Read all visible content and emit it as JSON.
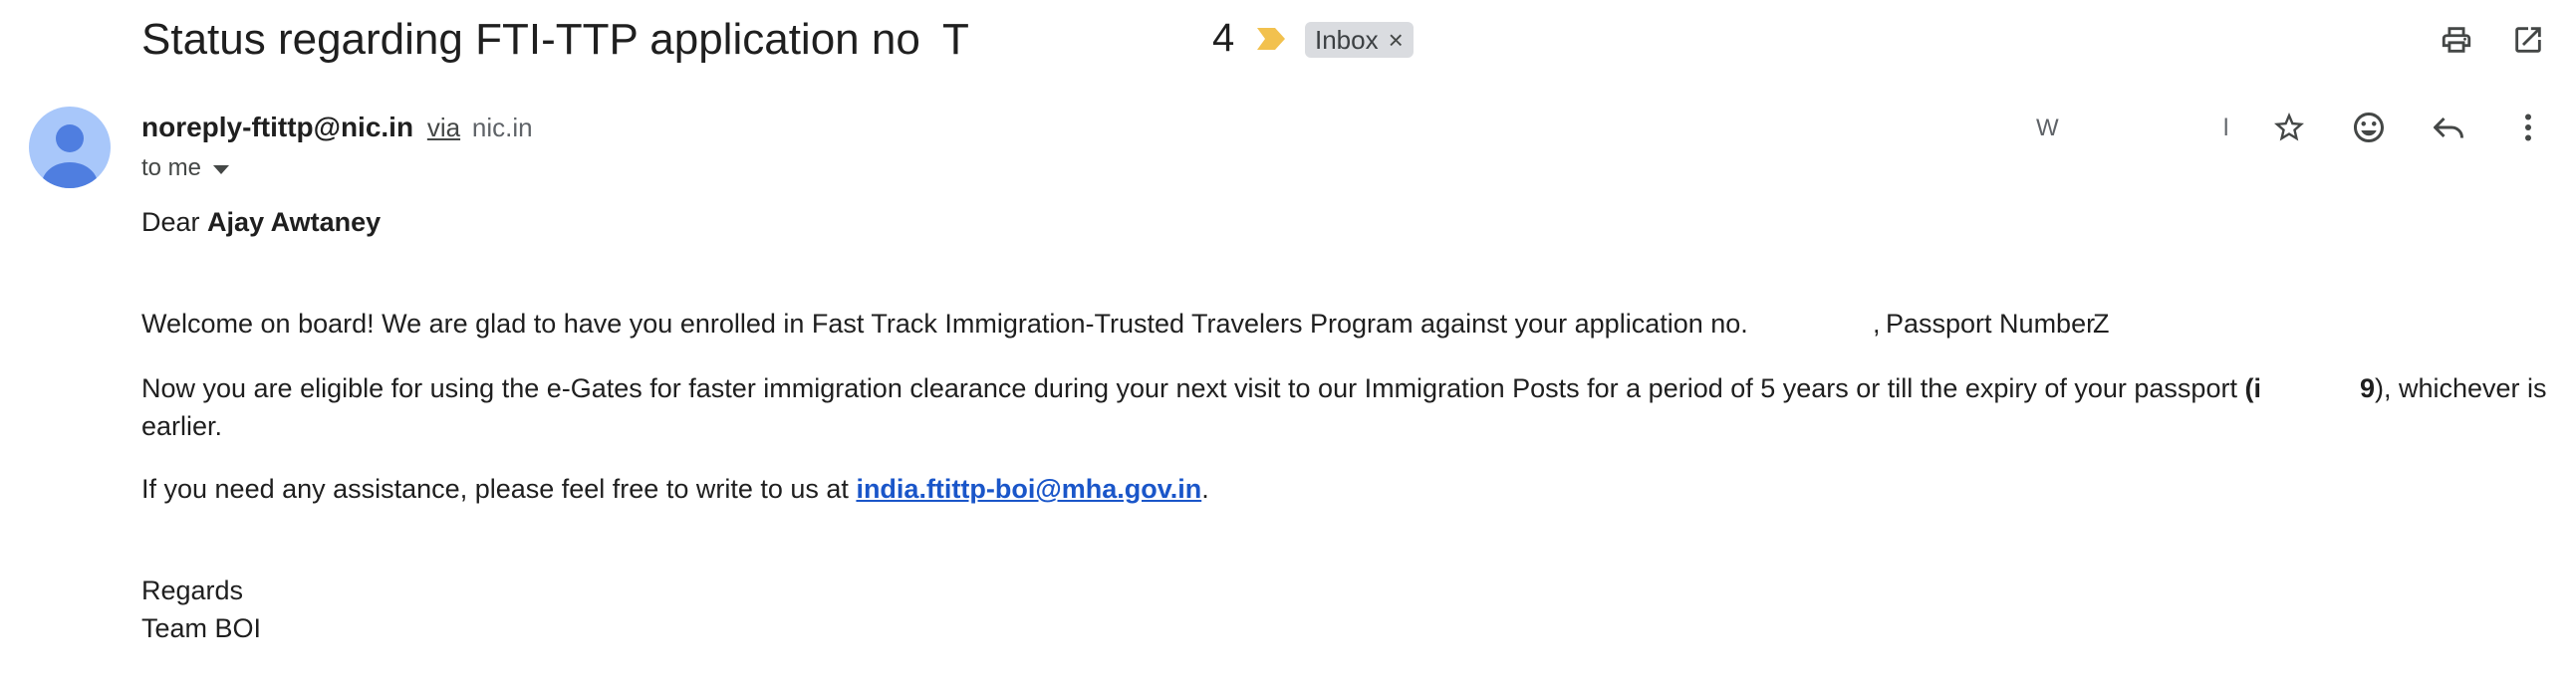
{
  "email": {
    "subject": "Status regarding FTI-TTP application no",
    "subject_frag_start": "T",
    "subject_frag_end": "4",
    "label_chip": "Inbox",
    "label_chip_close": "×",
    "sender_email": "noreply-ftittp@nic.in",
    "via_label": "via",
    "via_domain": "nic.in",
    "recipient_label": "to me",
    "date_frag_left": "W",
    "date_frag_right": "l"
  },
  "body": {
    "greeting_prefix": "Dear",
    "greeting_name": "Ajay Awtaney",
    "p1_text": "Welcome on board! We are glad to have you enrolled in Fast Track Immigration-Trusted Travelers Program against your application no.",
    "p1_frag_app": ",",
    "p1_passport_label": "Passport Number",
    "p1_frag_passport": "Z",
    "p2_line1": "Now you are eligible for using the e-Gates for faster immigration clearance during your next visit to our Immigration Posts for a period of 5 years or till the expiry of your passport",
    "p2_paren_open": "(i",
    "p2_paren_close": "9",
    "p2_tail": "), whichever is",
    "p2_line2": "earlier.",
    "p3_text": "If you need any assistance, please feel free to write to us at",
    "p3_link": "india.ftittp-boi@mha.gov.in",
    "p3_end": ".",
    "signoff": "Regards",
    "signature": "Team BOI"
  },
  "icons": {
    "print": "print-icon",
    "open_new_window": "open-in-new-icon",
    "star": "star-icon",
    "emoji": "emoji-icon",
    "reply": "reply-icon",
    "more": "more-vert-icon",
    "label_arrow": "important-marker-icon",
    "avatar": "default-avatar-icon"
  },
  "colors": {
    "label_arrow": "#f2c14e",
    "chip_bg": "#dadce0",
    "avatar_bg": "#a8c7fa",
    "avatar_fg": "#4f7ee0",
    "link": "#1a56c9"
  }
}
